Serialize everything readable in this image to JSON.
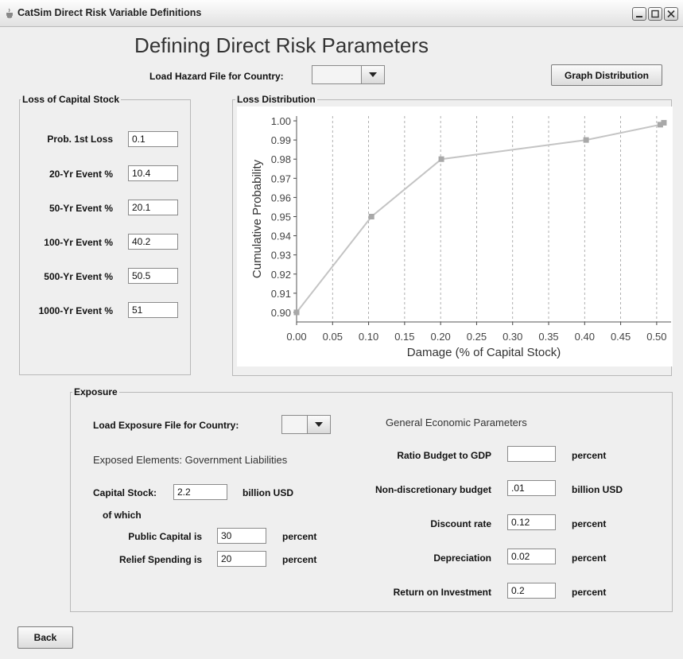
{
  "window": {
    "title": "CatSim Direct Risk Variable Definitions"
  },
  "header": {
    "title": "Defining Direct Risk Parameters",
    "load_hazard_label": "Load Hazard File for Country:",
    "hazard_country_value": "",
    "graph_button_label": "Graph Distribution"
  },
  "loss_capital": {
    "legend": "Loss of Capital Stock",
    "fields": [
      {
        "label": "Prob. 1st Loss",
        "value": "0.1"
      },
      {
        "label": "20-Yr Event %",
        "value": "10.4"
      },
      {
        "label": "50-Yr Event %",
        "value": "20.1"
      },
      {
        "label": "100-Yr Event %",
        "value": "40.2"
      },
      {
        "label": "500-Yr Event %",
        "value": "50.5"
      },
      {
        "label": "1000-Yr Event %",
        "value": "51"
      }
    ]
  },
  "loss_distribution": {
    "legend": "Loss Distribution"
  },
  "chart_data": {
    "type": "line",
    "xlabel": "Damage (% of Capital Stock)",
    "ylabel": "Cumulative Probability",
    "xlim": [
      0.0,
      0.52
    ],
    "ylim": [
      0.895,
      1.0025
    ],
    "x_ticks": [
      "0.00",
      "0.05",
      "0.10",
      "0.15",
      "0.20",
      "0.25",
      "0.30",
      "0.35",
      "0.40",
      "0.45",
      "0.50"
    ],
    "y_ticks": [
      "0.90",
      "0.91",
      "0.92",
      "0.93",
      "0.94",
      "0.95",
      "0.96",
      "0.97",
      "0.98",
      "0.99",
      "1.00"
    ],
    "grid": "vertical dashed",
    "series": [
      {
        "x": [
          0.0,
          0.104,
          0.201,
          0.402,
          0.505,
          0.51
        ],
        "y": [
          0.9,
          0.95,
          0.98,
          0.99,
          0.998,
          0.999
        ]
      }
    ],
    "colors": {
      "line": "#c4c4c4",
      "marker": "#a8a8a8",
      "grid": "#9c9c9c"
    }
  },
  "exposure": {
    "legend": "Exposure",
    "load_exposure_label": "Load Exposure File for Country:",
    "exposure_country_value": "",
    "exposed_elements": "Exposed Elements: Government Liabilities",
    "capital_stock_label": "Capital Stock:",
    "capital_stock_value": "2.2",
    "capital_stock_unit": "billion USD",
    "of_which": "of which",
    "public_capital_label": "Public Capital is",
    "public_capital_value": "30",
    "public_capital_unit": "percent",
    "relief_spending_label": "Relief Spending is",
    "relief_spending_value": "20",
    "relief_spending_unit": "percent",
    "general_econ_title": "General Economic Parameters",
    "params": [
      {
        "label": "Ratio Budget to GDP",
        "value": "",
        "unit": "percent"
      },
      {
        "label": "Non-discretionary budget",
        "value": ".01",
        "unit": "billion USD"
      },
      {
        "label": "Discount rate",
        "value": "0.12",
        "unit": "percent"
      },
      {
        "label": "Depreciation",
        "value": "0.02",
        "unit": "percent"
      },
      {
        "label": "Return on Investment",
        "value": "0.2",
        "unit": "percent"
      }
    ]
  },
  "footer": {
    "back_label": "Back"
  }
}
